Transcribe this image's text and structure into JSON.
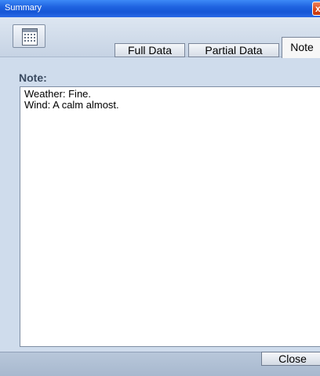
{
  "window": {
    "title": "Summary",
    "close_glyph": "x"
  },
  "header": {
    "calendar_icon": "calendar-icon",
    "tabs": [
      {
        "label": "Full Data",
        "active": false
      },
      {
        "label": "Partial Data",
        "active": false
      },
      {
        "label": "Note",
        "active": true
      }
    ]
  },
  "note": {
    "label": "Note:",
    "lines": [
      "Weather: Fine.",
      "Wind: A calm almost."
    ]
  },
  "footer": {
    "close_label": "Close"
  },
  "colors": {
    "titlebar": "#1656d6",
    "background": "#cfdcec",
    "label": "#3a4a60"
  }
}
